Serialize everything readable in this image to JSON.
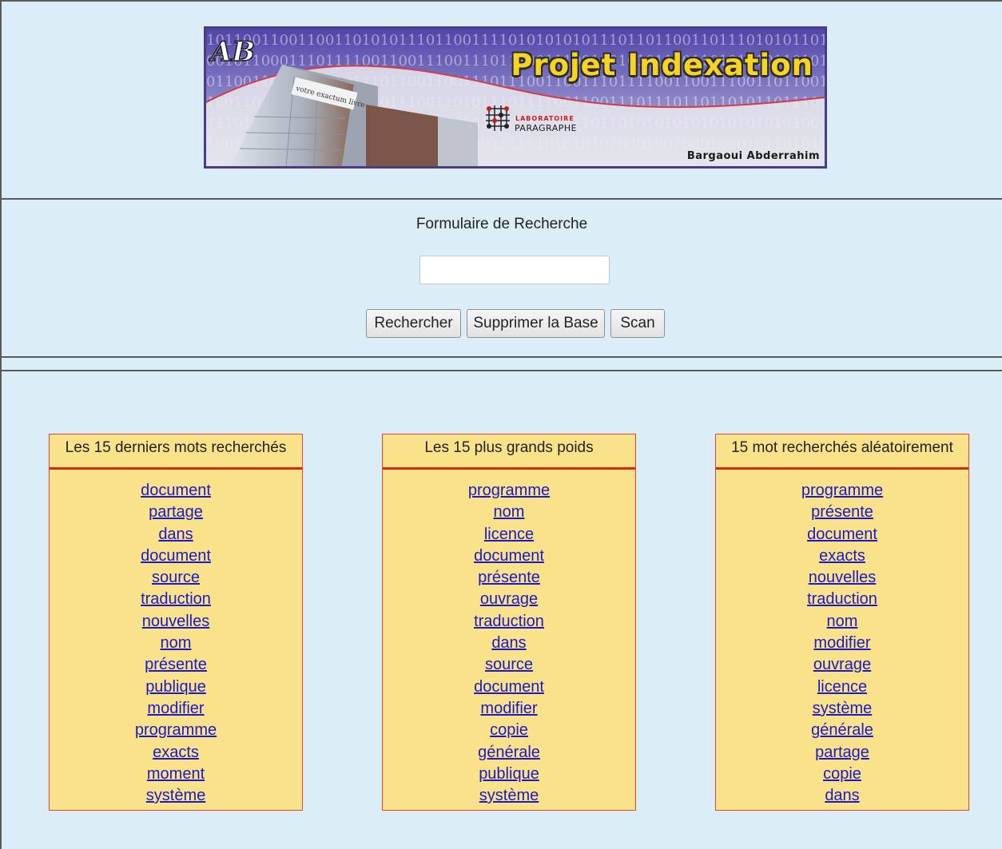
{
  "banner": {
    "title": "Projet Indexation",
    "author": "Bargaoui Abderrahim",
    "lab_line1": "LABORATOIRE",
    "lab_line2": "PARAGRAPHE",
    "logo_text": "AB",
    "binary_rows": [
      "10110011001100110101011101100111101010101011101101100110111010101101110001101",
      "001011000111011110011001110011101110011100110101011101101010101101011010101011",
      "011001100110101011101100110011101110011001110111100110011100110110011001",
      "10011011110011011010111001101011101111001100111011101101101011011100110101",
      "11101011101010111001101101101010101101011101101010101010101010101000101010100",
      "1001010101001000101110011110100111101010101010001001000100010110101010"
    ],
    "poster_text": "votre exactum livre"
  },
  "search": {
    "title": "Formulaire de Recherche",
    "input_value": "",
    "btn_search": "Rechercher",
    "btn_delete": "Supprimer la Base",
    "btn_scan": "Scan"
  },
  "boxes": [
    {
      "title": "Les 15 derniers mots recherchés",
      "words": [
        "document",
        "partage",
        "dans",
        "document",
        "source",
        "traduction",
        "nouvelles",
        "nom",
        "présente",
        "publique",
        "modifier",
        "programme",
        "exacts",
        "moment",
        "système"
      ]
    },
    {
      "title": "Les 15 plus grands poids",
      "words": [
        "programme",
        "nom",
        "licence",
        "document",
        "présente",
        "ouvrage",
        "traduction",
        "dans",
        "source",
        "document",
        "modifier",
        "copie",
        "générale",
        "publique",
        "système"
      ]
    },
    {
      "title": "15 mot recherchés aléatoirement",
      "words": [
        "programme",
        "présente",
        "document",
        "exacts",
        "nouvelles",
        "traduction",
        "nom",
        "modifier",
        "ouvrage",
        "licence",
        "système",
        "générale",
        "partage",
        "copie",
        "dans"
      ]
    }
  ],
  "colors": {
    "page_bg": "#dbeef8",
    "box_bg": "#fae28a",
    "box_border": "#e8452a",
    "link": "#1a1acc",
    "title_yellow": "#f7d322"
  }
}
